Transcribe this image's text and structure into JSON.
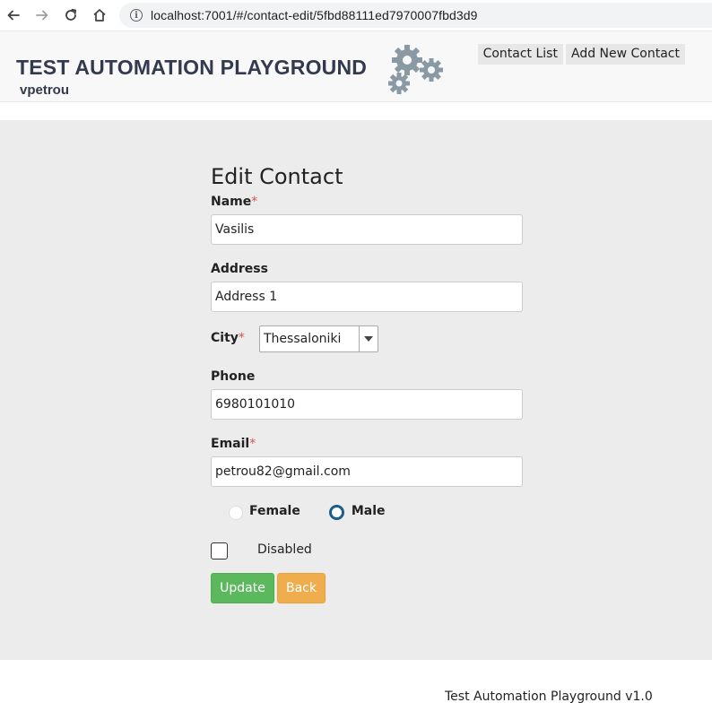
{
  "browser": {
    "url": "localhost:7001/#/contact-edit/5fbd88111ed7970007fbd3d9",
    "back_icon": "arrow-left-icon",
    "forward_icon": "arrow-right-icon",
    "reload_icon": "reload-icon",
    "home_icon": "home-icon",
    "info_icon": "info-icon"
  },
  "header": {
    "title": "TEST AUTOMATION PLAYGROUND",
    "user": "vpetrou",
    "logo_icon": "gears-icon",
    "nav": [
      {
        "label": "Contact List"
      },
      {
        "label": "Add New Contact"
      }
    ]
  },
  "form": {
    "title": "Edit Contact",
    "required_marker": "*",
    "name": {
      "label": "Name",
      "value": "Vasilis"
    },
    "address": {
      "label": "Address",
      "value": "Address 1"
    },
    "city": {
      "label": "City",
      "value": "Thessaloniki"
    },
    "phone": {
      "label": "Phone",
      "value": "6980101010"
    },
    "email": {
      "label": "Email",
      "value": "petrou82@gmail.com"
    },
    "gender": {
      "options": [
        {
          "label": "Female",
          "checked": false
        },
        {
          "label": "Male",
          "checked": true
        }
      ]
    },
    "disabled": {
      "label": "Disabled",
      "checked": false
    },
    "update_label": "Update",
    "back_label": "Back"
  },
  "footer": {
    "text": "Test Automation Playground v1.0"
  },
  "colors": {
    "update": "#5cb85c",
    "back": "#f0ad4e",
    "required": "#d9534f",
    "radio_checked": "#1a5c8a"
  }
}
